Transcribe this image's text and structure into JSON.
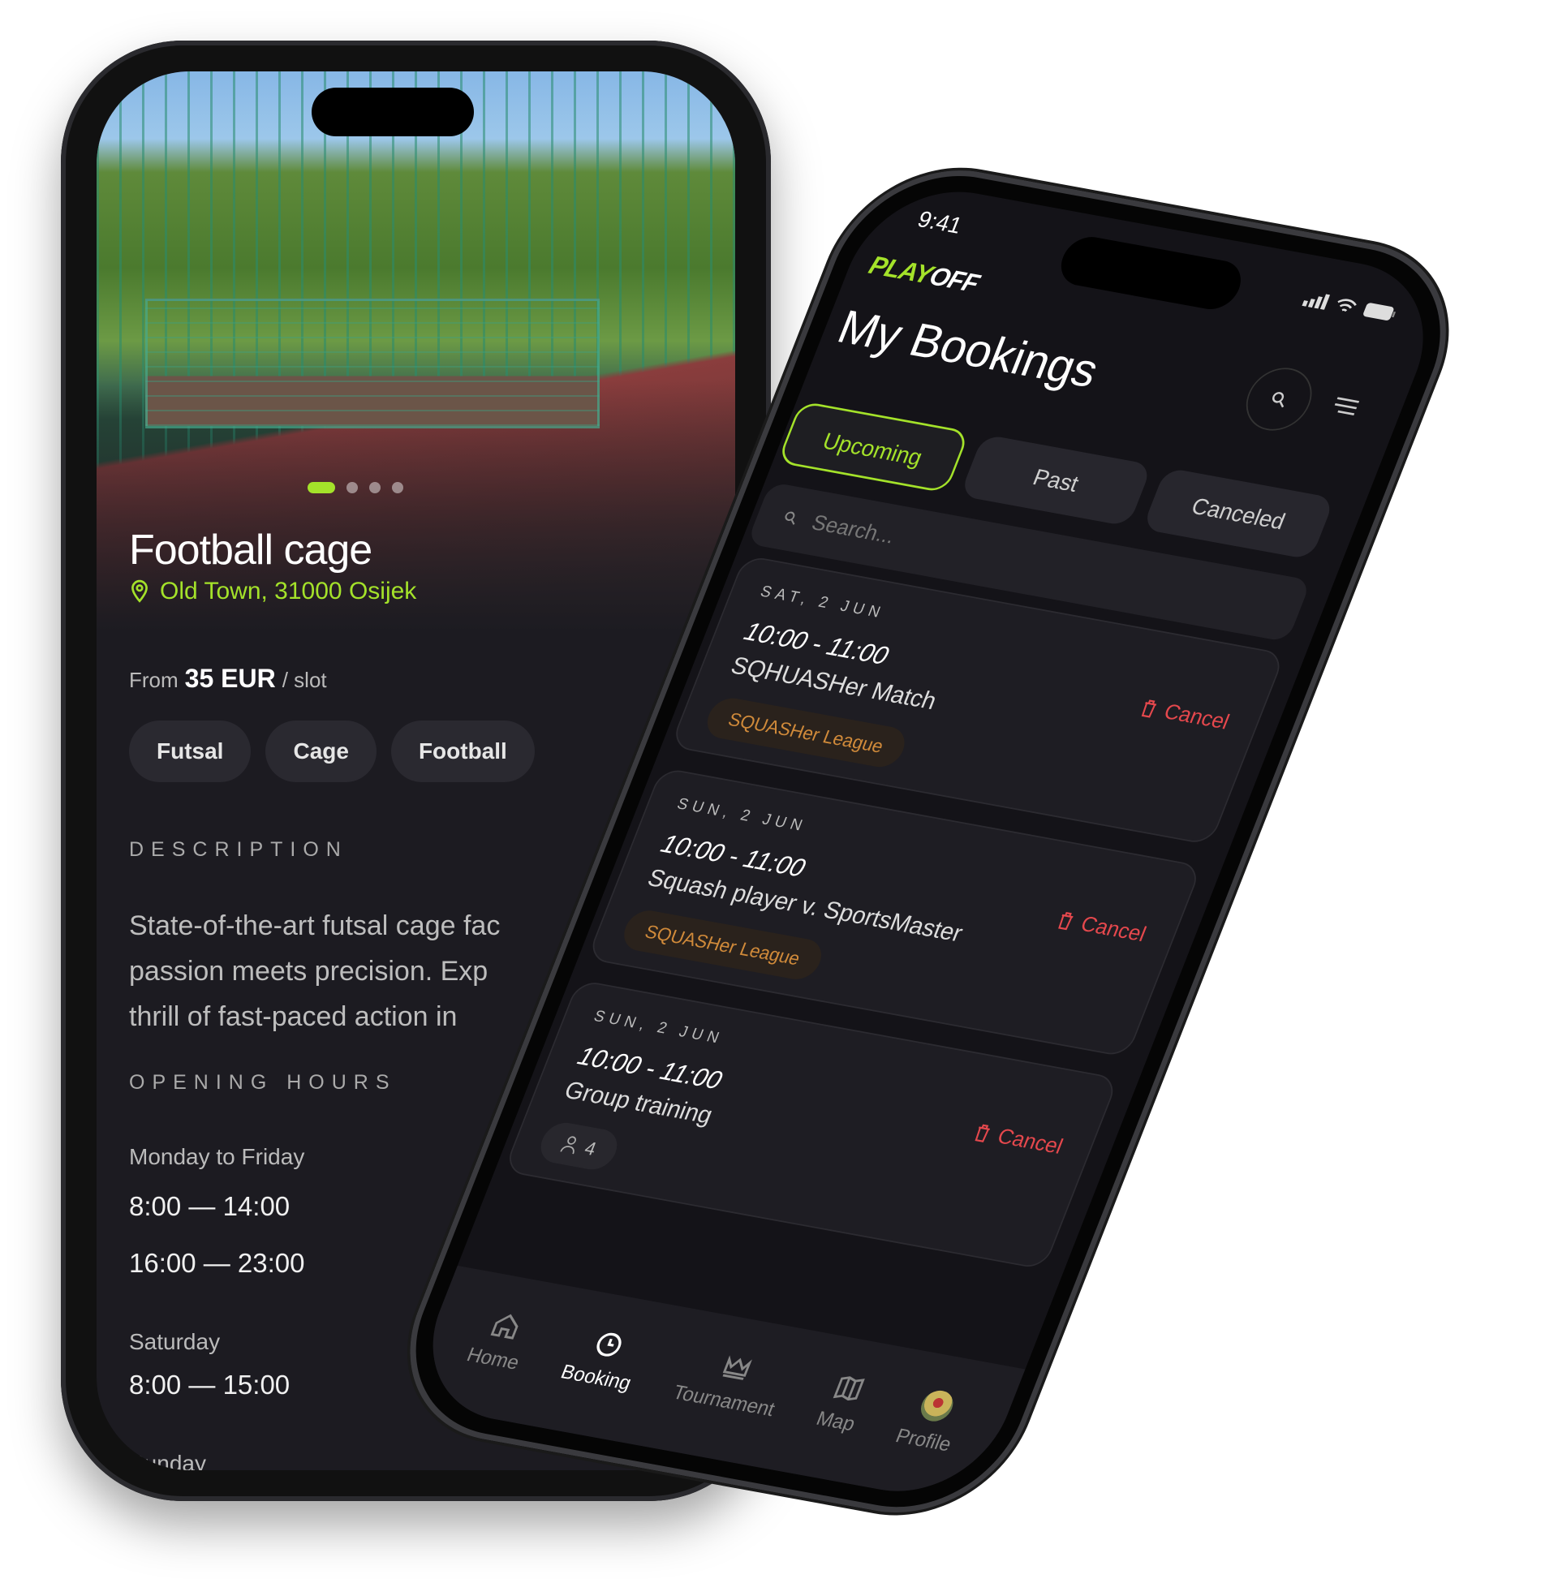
{
  "venue": {
    "title": "Football cage",
    "location": "Old Town, 31000 Osijek",
    "price_prefix": "From",
    "price": "35 EUR",
    "price_suffix": "/ slot",
    "carousel": {
      "slides": 4,
      "active": 1
    },
    "tags": [
      "Futsal",
      "Cage",
      "Football"
    ],
    "description_label": "DESCRIPTION",
    "description_lines": [
      "State-of-the-art futsal cage fac",
      "passion meets precision. Exp",
      "thrill of fast-paced action in"
    ],
    "hours_label": "OPENING HOURS",
    "hours": [
      {
        "day": "Monday to Friday",
        "slots": [
          "8:00 — 14:00",
          "16:00 — 23:00"
        ]
      },
      {
        "day": "Saturday",
        "slots": [
          "8:00 — 15:00"
        ]
      },
      {
        "day": "Sunday",
        "slots": []
      }
    ]
  },
  "bookings": {
    "status_time": "9:41",
    "logo": {
      "part1": "PLAY",
      "part2": "OFF"
    },
    "title": "My Bookings",
    "tabs": [
      {
        "label": "Upcoming",
        "active": true
      },
      {
        "label": "Past"
      },
      {
        "label": "Canceled"
      }
    ],
    "search_placeholder": "Search...",
    "cancel_label": "Cancel",
    "items": [
      {
        "date": "SAT, 2 JUN",
        "time": "10:00 - 11:00",
        "name": "SQHUASHer Match",
        "badge": "SQUASHer League"
      },
      {
        "date": "SUN, 2 JUN",
        "time": "10:00 - 11:00",
        "name": "Squash player v. SportsMaster",
        "badge": "SQUASHer League"
      },
      {
        "date": "SUN, 2 JUN",
        "time": "10:00 - 11:00",
        "name": "Group training",
        "participants": "4"
      }
    ],
    "nav": [
      {
        "label": "Home",
        "icon": "home-icon"
      },
      {
        "label": "Booking",
        "icon": "clock-icon",
        "active": true
      },
      {
        "label": "Tournament",
        "icon": "crown-icon"
      },
      {
        "label": "Map",
        "icon": "map-icon"
      },
      {
        "label": "Profile",
        "icon": "avatar"
      }
    ]
  },
  "colors": {
    "accent": "#a4e22a",
    "danger": "#e5484d",
    "badge": "#d08a3a",
    "background": "#1c1b21"
  }
}
